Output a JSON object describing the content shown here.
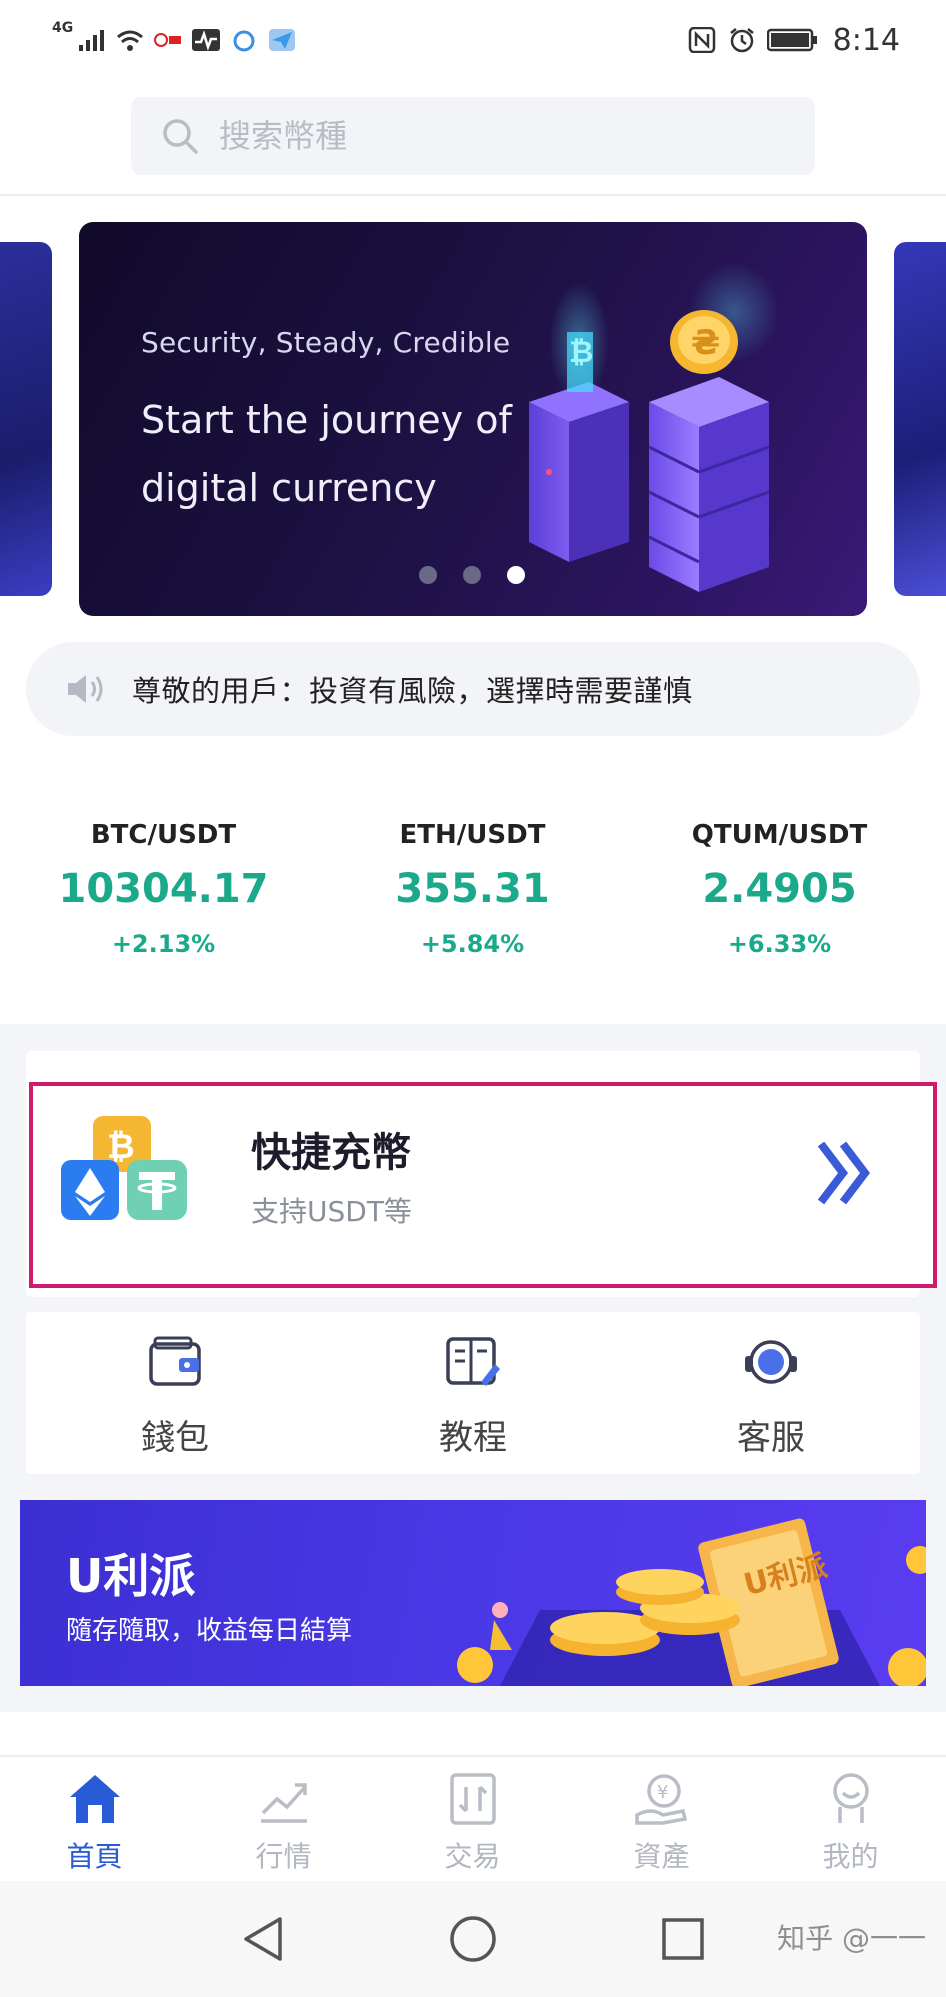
{
  "status_bar": {
    "network": "4G",
    "time": "8:14"
  },
  "search": {
    "placeholder": "搜索幣種",
    "icon": "search-icon"
  },
  "banner": {
    "subtitle": "Security, Steady, Credible",
    "title": "Start the journey of digital currency",
    "slides": 3,
    "active_slide": 3
  },
  "notice": {
    "icon": "speaker-icon",
    "text": "尊敬的用戶：投資有風險，選擇時需要謹慎"
  },
  "tickers": [
    {
      "pair": "BTC/USDT",
      "price": "10304.17",
      "change": "+2.13%"
    },
    {
      "pair": "ETH/USDT",
      "price": "355.31",
      "change": "+5.84%"
    },
    {
      "pair": "QTUM/USDT",
      "price": "2.4905",
      "change": "+6.33%"
    }
  ],
  "quick_deposit": {
    "title": "快捷充幣",
    "subtitle": "支持USDT等",
    "arrow_icon": "double-chevron-right-icon",
    "highlight_color": "#d01a6d"
  },
  "shortcuts": [
    {
      "label": "錢包",
      "icon": "wallet-icon"
    },
    {
      "label": "教程",
      "icon": "tutorial-icon"
    },
    {
      "label": "客服",
      "icon": "headset-icon"
    }
  ],
  "promo": {
    "title": "U利派",
    "subtitle": "隨存隨取，收益每日結算",
    "ticket_text": "U利派"
  },
  "bottom_nav": [
    {
      "label": "首頁",
      "icon": "home-icon",
      "active": true
    },
    {
      "label": "行情",
      "icon": "chart-icon",
      "active": false
    },
    {
      "label": "交易",
      "icon": "trade-icon",
      "active": false
    },
    {
      "label": "資產",
      "icon": "assets-icon",
      "active": false
    },
    {
      "label": "我的",
      "icon": "profile-icon",
      "active": false
    }
  ],
  "watermark": "知乎 @一一",
  "colors": {
    "accent": "#2a5bd7",
    "up": "#1aa98a",
    "highlight": "#d01a6d"
  }
}
